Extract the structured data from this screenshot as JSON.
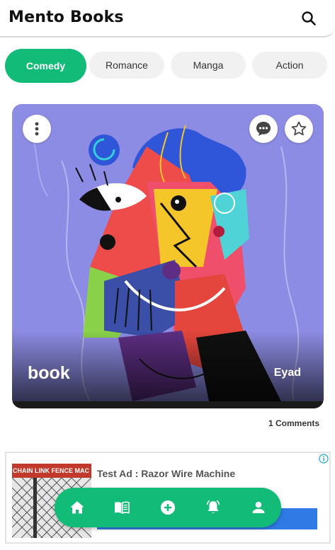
{
  "app": {
    "title": "Mento Books"
  },
  "categories": [
    {
      "label": "Comedy",
      "active": true
    },
    {
      "label": "Romance",
      "active": false
    },
    {
      "label": "Manga",
      "active": false
    },
    {
      "label": "Action",
      "active": false
    }
  ],
  "book": {
    "title": "book",
    "author": "Eyad",
    "comments_label": "1 Comments"
  },
  "ad": {
    "title": "Test Ad : Razor Wire Machine",
    "image_banner": "CHAIN LINK FENCE MAC"
  },
  "bottom_nav": [
    "home-icon",
    "book-icon",
    "add-icon",
    "bell-icon",
    "person-icon"
  ],
  "colors": {
    "accent": "#12bb77",
    "tab_bg": "#f1f1f1",
    "card_bg": "#8d8ce4",
    "ad_button": "#2f7ae5"
  }
}
